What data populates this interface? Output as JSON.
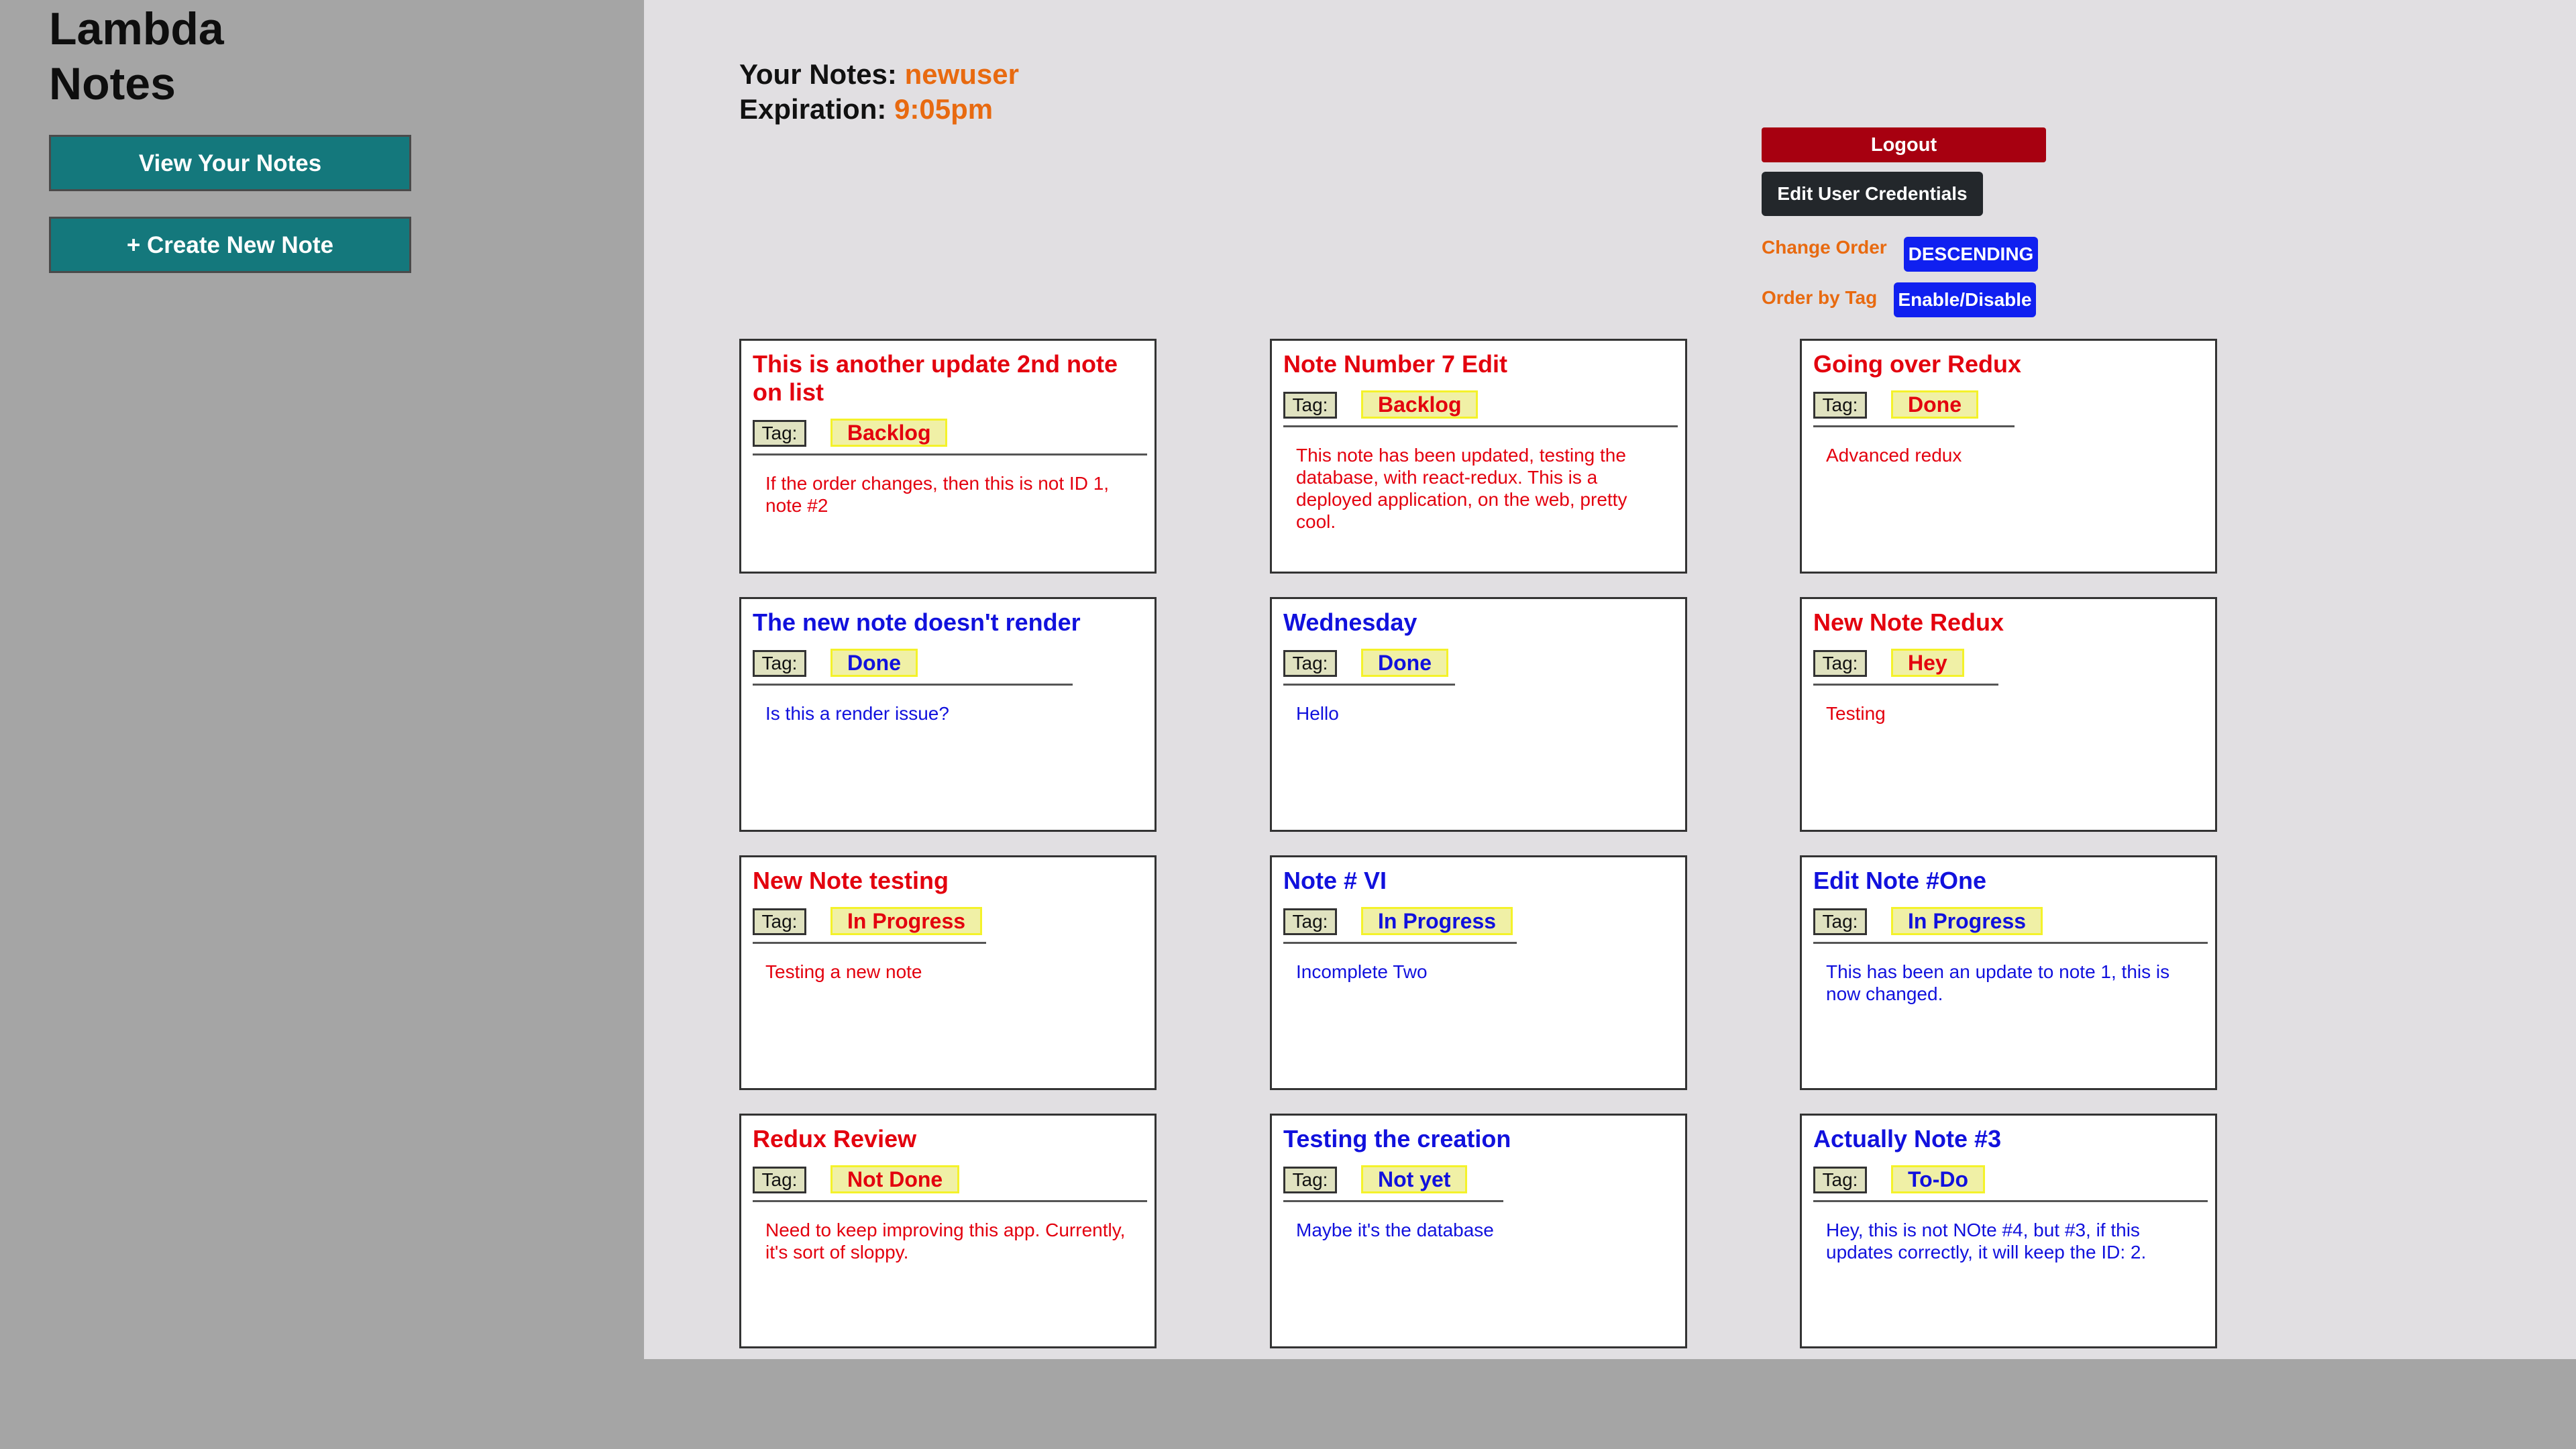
{
  "sidebar": {
    "title_line1": "Lambda",
    "title_line2": "Notes",
    "view_notes_label": "View Your Notes",
    "create_note_label": "+ Create New Note"
  },
  "header": {
    "notes_prefix": "Your Notes:",
    "username": "newuser",
    "expiration_prefix": "Expiration:",
    "expiration_time": "9:05pm"
  },
  "controls": {
    "logout_label": "Logout",
    "edit_credentials_label": "Edit User Credentials",
    "change_order_label": "Change Order",
    "order_button_label": "DESCENDING",
    "order_by_tag_label": "Order by Tag",
    "toggle_button_label": "Enable/Disable"
  },
  "colors": {
    "accent": "#e86a10",
    "note_red": "#e3000e",
    "note_blue": "#1111dd",
    "sidebar_button": "#14787c",
    "logout": "#a70010",
    "toggle_buttons": "#1020f0"
  },
  "notes": [
    {
      "title": "This is another update 2nd note on list",
      "tag_label": "Tag:",
      "tag": "Backlog",
      "body": "If the order changes, then this is not ID 1, note #2",
      "color": "red"
    },
    {
      "title": "Note Number 7 Edit",
      "tag_label": "Tag:",
      "tag": "Backlog",
      "body": "This note has been updated, testing the database, with react-redux. This is a deployed application, on the web, pretty cool.",
      "color": "red"
    },
    {
      "title": "Going over Redux",
      "tag_label": "Tag:",
      "tag": "Done",
      "body": "Advanced redux",
      "color": "red"
    },
    {
      "title": "The new note doesn't render",
      "tag_label": "Tag:",
      "tag": "Done",
      "body": "Is this a render issue?",
      "color": "blue"
    },
    {
      "title": "Wednesday",
      "tag_label": "Tag:",
      "tag": "Done",
      "body": "Hello",
      "color": "blue"
    },
    {
      "title": "New Note Redux",
      "tag_label": "Tag:",
      "tag": "Hey",
      "body": "Testing",
      "color": "red"
    },
    {
      "title": "New Note testing",
      "tag_label": "Tag:",
      "tag": "In Progress",
      "body": "Testing a new note",
      "color": "red"
    },
    {
      "title": "Note # VI",
      "tag_label": "Tag:",
      "tag": "In Progress",
      "body": "Incomplete Two",
      "color": "blue"
    },
    {
      "title": "Edit Note #One",
      "tag_label": "Tag:",
      "tag": "In Progress",
      "body": "This has been an update to note 1, this is now changed.",
      "color": "blue"
    },
    {
      "title": "Redux Review",
      "tag_label": "Tag:",
      "tag": "Not Done",
      "body": "Need to keep improving this app. Currently, it's sort of sloppy.",
      "color": "red"
    },
    {
      "title": "Testing the creation",
      "tag_label": "Tag:",
      "tag": "Not yet",
      "body": "Maybe it's the database",
      "color": "blue"
    },
    {
      "title": "Actually Note #3",
      "tag_label": "Tag:",
      "tag": "To-Do",
      "body": "Hey, this is not NOte #4, but #3, if this updates correctly, it will keep the ID: 2.",
      "color": "blue"
    }
  ]
}
